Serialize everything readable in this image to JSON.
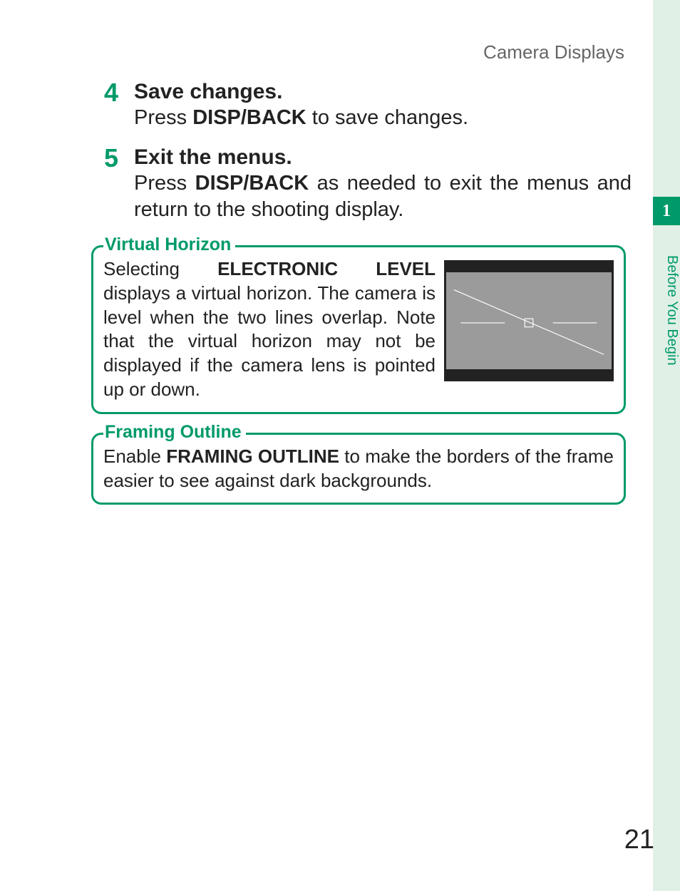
{
  "header": "Camera Displays",
  "sideTab": {
    "chapter": "1",
    "label": "Before You Begin"
  },
  "steps": [
    {
      "num": "4",
      "title": "Save changes.",
      "body_pre": "Press ",
      "body_kw": "DISP/BACK",
      "body_post": " to save changes."
    },
    {
      "num": "5",
      "title": "Exit the menus.",
      "body_pre": "Press ",
      "body_kw": "DISP/BACK",
      "body_post": " as needed to exit the menus and return to the shooting display."
    }
  ],
  "callouts": {
    "vh": {
      "legend": "Virtual Horizon",
      "text_pre": "Selecting ",
      "text_kw": "ELECTRONIC LEVEL",
      "text_post": " displays a virtual horizon. The camera is level when the two lines overlap. Note that the virtual horizon may not be displayed if the camera lens is pointed up or down."
    },
    "fo": {
      "legend": "Framing Outline",
      "text_pre": "Enable ",
      "text_kw": "FRAMING OUTLINE",
      "text_post": " to make the borders of the frame easier to see against dark backgrounds."
    }
  },
  "pageNumber": "21"
}
